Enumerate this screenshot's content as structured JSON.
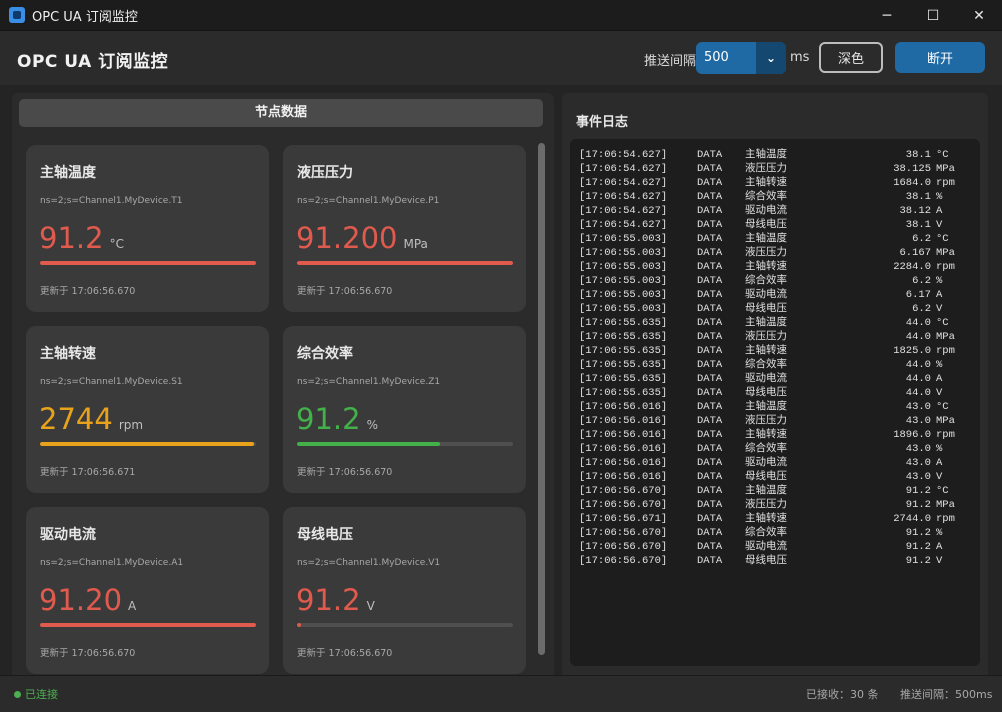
{
  "window": {
    "title": "OPC UA 订阅监控",
    "controls": [
      "─",
      "☐",
      "✕"
    ]
  },
  "header": {
    "title": "OPC UA 订阅监控",
    "interval_label": "推送间隔",
    "interval_value": "500",
    "interval_unit": "ms",
    "theme_button": "深色",
    "disconnect_button": "断开",
    "accent_color": "#1f6aa5"
  },
  "nodes_panel": {
    "heading": "节点数据",
    "cards": [
      {
        "title": "主轴温度",
        "node": "ns=2;s=Channel1.MyDevice.T1",
        "value": "91.2",
        "unit": "°C",
        "progress": 1.0,
        "color": "#e05a4e",
        "updated": "更新于 17:06:56.670"
      },
      {
        "title": "液压压力",
        "node": "ns=2;s=Channel1.MyDevice.P1",
        "value": "91.200",
        "unit": "MPa",
        "progress": 1.0,
        "color": "#e05a4e",
        "updated": "更新于 17:06:56.670"
      },
      {
        "title": "主轴转速",
        "node": "ns=2;s=Channel1.MyDevice.S1",
        "value": "2744",
        "unit": "rpm",
        "progress": 0.99,
        "color": "#e8a21c",
        "updated": "更新于 17:06:56.671"
      },
      {
        "title": "综合效率",
        "node": "ns=2;s=Channel1.MyDevice.Z1",
        "value": "91.2",
        "unit": "%",
        "progress": 0.66,
        "color": "#43b049",
        "updated": "更新于 17:06:56.670"
      },
      {
        "title": "驱动电流",
        "node": "ns=2;s=Channel1.MyDevice.A1",
        "value": "91.20",
        "unit": "A",
        "progress": 1.0,
        "color": "#e05a4e",
        "updated": "更新于 17:06:56.670"
      },
      {
        "title": "母线电压",
        "node": "ns=2;s=Channel1.MyDevice.V1",
        "value": "91.2",
        "unit": "V",
        "progress": 0.02,
        "color": "#e05a4e",
        "updated": "更新于 17:06:56.670"
      }
    ]
  },
  "log_panel": {
    "title": "事件日志",
    "lines": [
      {
        "time": "[17:06:54.627]",
        "kind": "DATA",
        "name": "主轴温度",
        "value": "38.1",
        "unit": "°C"
      },
      {
        "time": "[17:06:54.627]",
        "kind": "DATA",
        "name": "液压压力",
        "value": "38.125",
        "unit": "MPa"
      },
      {
        "time": "[17:06:54.627]",
        "kind": "DATA",
        "name": "主轴转速",
        "value": "1684.0",
        "unit": "rpm"
      },
      {
        "time": "[17:06:54.627]",
        "kind": "DATA",
        "name": "综合效率",
        "value": "38.1",
        "unit": "%"
      },
      {
        "time": "[17:06:54.627]",
        "kind": "DATA",
        "name": "驱动电流",
        "value": "38.12",
        "unit": "A"
      },
      {
        "time": "[17:06:54.627]",
        "kind": "DATA",
        "name": "母线电压",
        "value": "38.1",
        "unit": "V"
      },
      {
        "time": "[17:06:55.003]",
        "kind": "DATA",
        "name": "主轴温度",
        "value": "6.2",
        "unit": "°C"
      },
      {
        "time": "[17:06:55.003]",
        "kind": "DATA",
        "name": "液压压力",
        "value": "6.167",
        "unit": "MPa"
      },
      {
        "time": "[17:06:55.003]",
        "kind": "DATA",
        "name": "主轴转速",
        "value": "2284.0",
        "unit": "rpm"
      },
      {
        "time": "[17:06:55.003]",
        "kind": "DATA",
        "name": "综合效率",
        "value": "6.2",
        "unit": "%"
      },
      {
        "time": "[17:06:55.003]",
        "kind": "DATA",
        "name": "驱动电流",
        "value": "6.17",
        "unit": "A"
      },
      {
        "time": "[17:06:55.003]",
        "kind": "DATA",
        "name": "母线电压",
        "value": "6.2",
        "unit": "V"
      },
      {
        "time": "[17:06:55.635]",
        "kind": "DATA",
        "name": "主轴温度",
        "value": "44.0",
        "unit": "°C"
      },
      {
        "time": "[17:06:55.635]",
        "kind": "DATA",
        "name": "液压压力",
        "value": "44.0",
        "unit": "MPa"
      },
      {
        "time": "[17:06:55.635]",
        "kind": "DATA",
        "name": "主轴转速",
        "value": "1825.0",
        "unit": "rpm"
      },
      {
        "time": "[17:06:55.635]",
        "kind": "DATA",
        "name": "综合效率",
        "value": "44.0",
        "unit": "%"
      },
      {
        "time": "[17:06:55.635]",
        "kind": "DATA",
        "name": "驱动电流",
        "value": "44.0",
        "unit": "A"
      },
      {
        "time": "[17:06:55.635]",
        "kind": "DATA",
        "name": "母线电压",
        "value": "44.0",
        "unit": "V"
      },
      {
        "time": "[17:06:56.016]",
        "kind": "DATA",
        "name": "主轴温度",
        "value": "43.0",
        "unit": "°C"
      },
      {
        "time": "[17:06:56.016]",
        "kind": "DATA",
        "name": "液压压力",
        "value": "43.0",
        "unit": "MPa"
      },
      {
        "time": "[17:06:56.016]",
        "kind": "DATA",
        "name": "主轴转速",
        "value": "1896.0",
        "unit": "rpm"
      },
      {
        "time": "[17:06:56.016]",
        "kind": "DATA",
        "name": "综合效率",
        "value": "43.0",
        "unit": "%"
      },
      {
        "time": "[17:06:56.016]",
        "kind": "DATA",
        "name": "驱动电流",
        "value": "43.0",
        "unit": "A"
      },
      {
        "time": "[17:06:56.016]",
        "kind": "DATA",
        "name": "母线电压",
        "value": "43.0",
        "unit": "V"
      },
      {
        "time": "[17:06:56.670]",
        "kind": "DATA",
        "name": "主轴温度",
        "value": "91.2",
        "unit": "°C"
      },
      {
        "time": "[17:06:56.670]",
        "kind": "DATA",
        "name": "液压压力",
        "value": "91.2",
        "unit": "MPa"
      },
      {
        "time": "[17:06:56.671]",
        "kind": "DATA",
        "name": "主轴转速",
        "value": "2744.0",
        "unit": "rpm"
      },
      {
        "time": "[17:06:56.670]",
        "kind": "DATA",
        "name": "综合效率",
        "value": "91.2",
        "unit": "%"
      },
      {
        "time": "[17:06:56.670]",
        "kind": "DATA",
        "name": "驱动电流",
        "value": "91.2",
        "unit": "A"
      },
      {
        "time": "[17:06:56.670]",
        "kind": "DATA",
        "name": "母线电压",
        "value": "91.2",
        "unit": "V"
      }
    ]
  },
  "status": {
    "connection": "已连接",
    "connection_color": "#4caf50",
    "received": "已接收：30 条",
    "interval": "推送间隔：500ms"
  }
}
